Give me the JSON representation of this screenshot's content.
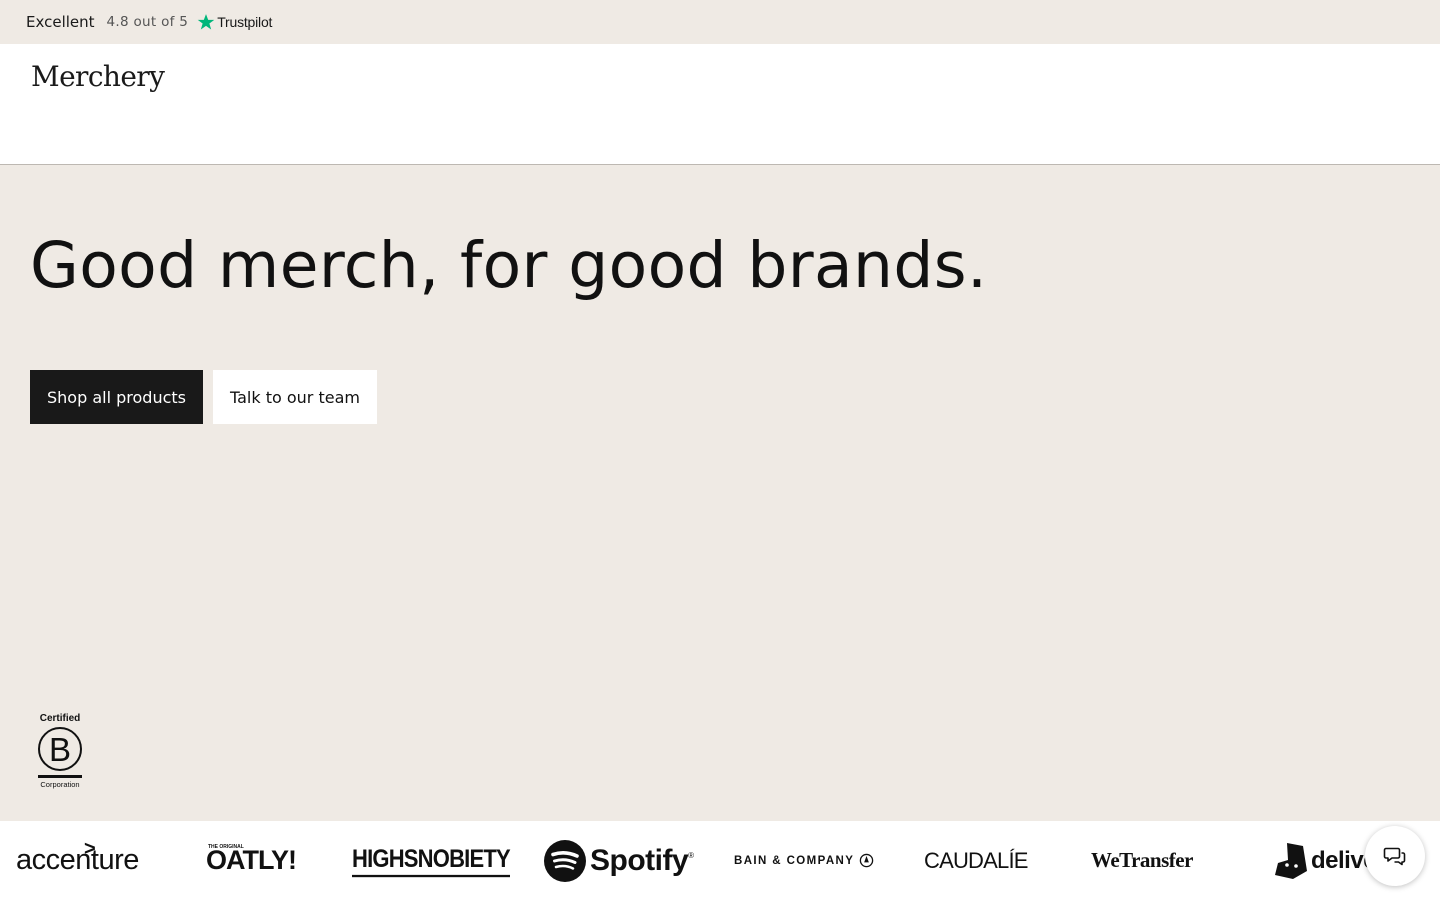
{
  "trust_bar": {
    "label": "Excellent",
    "rating_text": "4.8 out of 5",
    "provider": "Trustpilot",
    "star_color": "#00b67a"
  },
  "header": {
    "logo": "Merchery"
  },
  "hero": {
    "headline": "Good merch, for good brands.",
    "primary_button": "Shop all products",
    "secondary_button": "Talk to our team"
  },
  "certification": {
    "top_text": "Certified",
    "letter": "B",
    "bottom_text": "Corporation"
  },
  "brands": {
    "accenture": "accenture",
    "accenture_mark": ">",
    "oatly_small": "THE ORIGINAL",
    "oatly": "OATLY!",
    "highsnobiety": "HIGHSNOBIETY",
    "spotify": "Spotify",
    "spotify_mark": "®",
    "bain": "BAIN & COMPANY",
    "caudalie": "CAUDALÍE",
    "wetransfer": "WeTransfer",
    "deliveroo_partial": "delive"
  },
  "chat": {
    "icon": "chat-bubbles-icon"
  }
}
